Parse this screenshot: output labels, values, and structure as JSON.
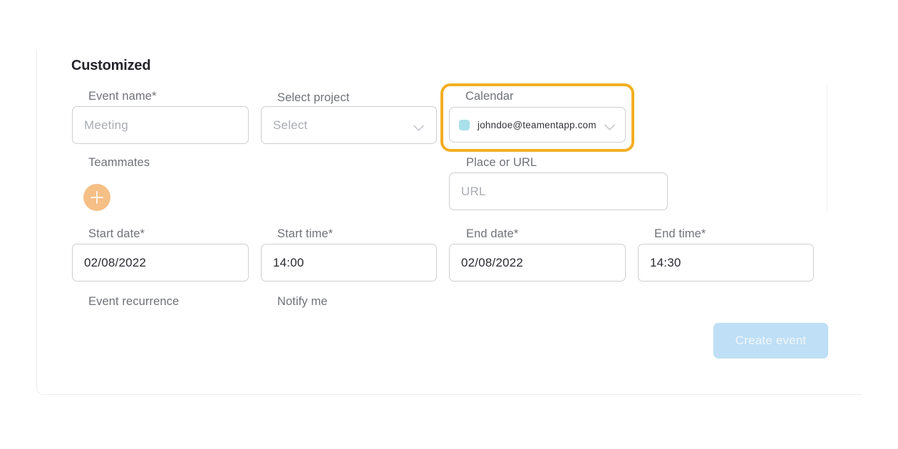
{
  "card": {
    "title": "Customized"
  },
  "form": {
    "event_name": {
      "label": "Event name*",
      "value": "",
      "placeholder": "Meeting"
    },
    "select_project": {
      "label": "Select project",
      "value": "Select",
      "icon": "chevron-down-icon"
    },
    "calendar": {
      "label": "Calendar",
      "value": "johndoe@teamentapp.com",
      "avatar_color": "#a9e0ea",
      "icon": "chevron-down-icon",
      "highlight_color": "#f2af22"
    },
    "teammates": {
      "label": "Teammates",
      "add_button_icon": "plus-icon",
      "add_button_color": "#f5bf85"
    },
    "place_or_url": {
      "label": "Place or URL",
      "value": "",
      "placeholder": "URL"
    },
    "start_date": {
      "label": "Start date*",
      "value": "02/08/2022"
    },
    "start_time": {
      "label": "Start time*",
      "value": "14:00"
    },
    "end_date": {
      "label": "End date*",
      "value": "02/08/2022"
    },
    "end_time": {
      "label": "End time*",
      "value": "14:30"
    },
    "event_recurrence": {
      "label": "Event recurrence"
    },
    "notify_me": {
      "label": "Notify me"
    }
  },
  "actions": {
    "create_event_label": "Create event",
    "create_event_color": "#bedff5"
  }
}
